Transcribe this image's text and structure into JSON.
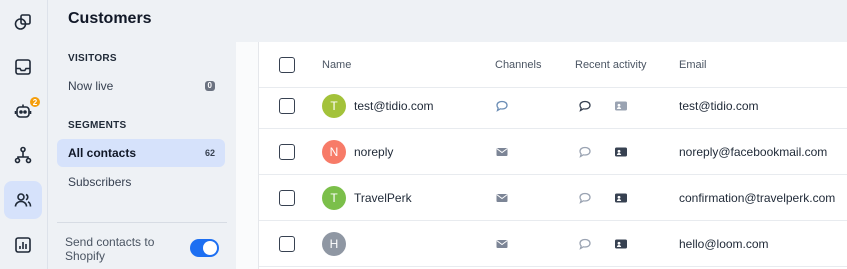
{
  "app": {
    "title": "Customers"
  },
  "rail": {
    "items": [
      {
        "icon": "shapes-icon"
      },
      {
        "icon": "inbox-icon"
      },
      {
        "icon": "bot-icon",
        "badge": "2"
      },
      {
        "icon": "flows-icon"
      },
      {
        "icon": "contacts-icon"
      },
      {
        "icon": "analytics-icon"
      }
    ]
  },
  "sidebar": {
    "visitors_label": "VISITORS",
    "now_live_label": "Now live",
    "now_live_count": "0",
    "segments_label": "SEGMENTS",
    "all_contacts_label": "All contacts",
    "all_contacts_count": "62",
    "subscribers_label": "Subscribers",
    "shopify_label": "Send contacts to Shopify",
    "shopify_enabled": true
  },
  "table": {
    "columns": {
      "name": "Name",
      "channels": "Channels",
      "recent_activity": "Recent activity",
      "email": "Email"
    },
    "rows": [
      {
        "initial": "T",
        "avatar_color": "#a3c23a",
        "name": "test@tidio.com",
        "channel_icon": "chat-icon",
        "activity": [
          "chat-icon",
          "contact-card-icon"
        ],
        "email": "test@tidio.com"
      },
      {
        "initial": "N",
        "avatar_color": "#f77b68",
        "name": "noreply",
        "channel_icon": "mail-icon",
        "activity": [
          "chat-icon",
          "contact-card-icon"
        ],
        "email": "noreply@facebookmail.com"
      },
      {
        "initial": "T",
        "avatar_color": "#7bbf4a",
        "name": "TravelPerk",
        "channel_icon": "mail-icon",
        "activity": [
          "chat-icon",
          "contact-card-icon"
        ],
        "email": "confirmation@travelperk.com"
      },
      {
        "initial": "H",
        "avatar_color": "#8f97a3",
        "name": "",
        "channel_icon": "mail-icon",
        "activity": [
          "chat-icon",
          "contact-card-icon"
        ],
        "email": "hello@loom.com"
      }
    ]
  },
  "colors": {
    "accent": "#1d6ff2",
    "active_bg": "#d6e2fb",
    "badge": "#f59e0b"
  }
}
